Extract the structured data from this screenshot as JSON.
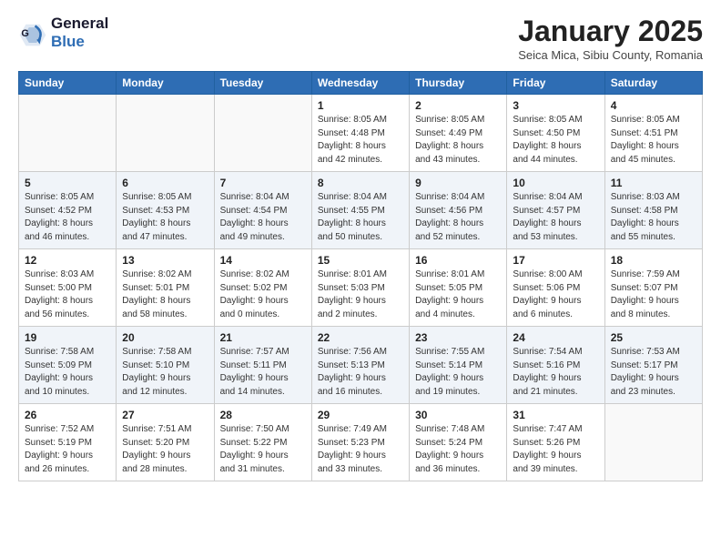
{
  "header": {
    "logo_line1": "General",
    "logo_line2": "Blue",
    "month_title": "January 2025",
    "subtitle": "Seica Mica, Sibiu County, Romania"
  },
  "weekdays": [
    "Sunday",
    "Monday",
    "Tuesday",
    "Wednesday",
    "Thursday",
    "Friday",
    "Saturday"
  ],
  "weeks": [
    [
      {
        "day": "",
        "sunrise": "",
        "sunset": "",
        "daylight": ""
      },
      {
        "day": "",
        "sunrise": "",
        "sunset": "",
        "daylight": ""
      },
      {
        "day": "",
        "sunrise": "",
        "sunset": "",
        "daylight": ""
      },
      {
        "day": "1",
        "sunrise": "Sunrise: 8:05 AM",
        "sunset": "Sunset: 4:48 PM",
        "daylight": "Daylight: 8 hours and 42 minutes."
      },
      {
        "day": "2",
        "sunrise": "Sunrise: 8:05 AM",
        "sunset": "Sunset: 4:49 PM",
        "daylight": "Daylight: 8 hours and 43 minutes."
      },
      {
        "day": "3",
        "sunrise": "Sunrise: 8:05 AM",
        "sunset": "Sunset: 4:50 PM",
        "daylight": "Daylight: 8 hours and 44 minutes."
      },
      {
        "day": "4",
        "sunrise": "Sunrise: 8:05 AM",
        "sunset": "Sunset: 4:51 PM",
        "daylight": "Daylight: 8 hours and 45 minutes."
      }
    ],
    [
      {
        "day": "5",
        "sunrise": "Sunrise: 8:05 AM",
        "sunset": "Sunset: 4:52 PM",
        "daylight": "Daylight: 8 hours and 46 minutes."
      },
      {
        "day": "6",
        "sunrise": "Sunrise: 8:05 AM",
        "sunset": "Sunset: 4:53 PM",
        "daylight": "Daylight: 8 hours and 47 minutes."
      },
      {
        "day": "7",
        "sunrise": "Sunrise: 8:04 AM",
        "sunset": "Sunset: 4:54 PM",
        "daylight": "Daylight: 8 hours and 49 minutes."
      },
      {
        "day": "8",
        "sunrise": "Sunrise: 8:04 AM",
        "sunset": "Sunset: 4:55 PM",
        "daylight": "Daylight: 8 hours and 50 minutes."
      },
      {
        "day": "9",
        "sunrise": "Sunrise: 8:04 AM",
        "sunset": "Sunset: 4:56 PM",
        "daylight": "Daylight: 8 hours and 52 minutes."
      },
      {
        "day": "10",
        "sunrise": "Sunrise: 8:04 AM",
        "sunset": "Sunset: 4:57 PM",
        "daylight": "Daylight: 8 hours and 53 minutes."
      },
      {
        "day": "11",
        "sunrise": "Sunrise: 8:03 AM",
        "sunset": "Sunset: 4:58 PM",
        "daylight": "Daylight: 8 hours and 55 minutes."
      }
    ],
    [
      {
        "day": "12",
        "sunrise": "Sunrise: 8:03 AM",
        "sunset": "Sunset: 5:00 PM",
        "daylight": "Daylight: 8 hours and 56 minutes."
      },
      {
        "day": "13",
        "sunrise": "Sunrise: 8:02 AM",
        "sunset": "Sunset: 5:01 PM",
        "daylight": "Daylight: 8 hours and 58 minutes."
      },
      {
        "day": "14",
        "sunrise": "Sunrise: 8:02 AM",
        "sunset": "Sunset: 5:02 PM",
        "daylight": "Daylight: 9 hours and 0 minutes."
      },
      {
        "day": "15",
        "sunrise": "Sunrise: 8:01 AM",
        "sunset": "Sunset: 5:03 PM",
        "daylight": "Daylight: 9 hours and 2 minutes."
      },
      {
        "day": "16",
        "sunrise": "Sunrise: 8:01 AM",
        "sunset": "Sunset: 5:05 PM",
        "daylight": "Daylight: 9 hours and 4 minutes."
      },
      {
        "day": "17",
        "sunrise": "Sunrise: 8:00 AM",
        "sunset": "Sunset: 5:06 PM",
        "daylight": "Daylight: 9 hours and 6 minutes."
      },
      {
        "day": "18",
        "sunrise": "Sunrise: 7:59 AM",
        "sunset": "Sunset: 5:07 PM",
        "daylight": "Daylight: 9 hours and 8 minutes."
      }
    ],
    [
      {
        "day": "19",
        "sunrise": "Sunrise: 7:58 AM",
        "sunset": "Sunset: 5:09 PM",
        "daylight": "Daylight: 9 hours and 10 minutes."
      },
      {
        "day": "20",
        "sunrise": "Sunrise: 7:58 AM",
        "sunset": "Sunset: 5:10 PM",
        "daylight": "Daylight: 9 hours and 12 minutes."
      },
      {
        "day": "21",
        "sunrise": "Sunrise: 7:57 AM",
        "sunset": "Sunset: 5:11 PM",
        "daylight": "Daylight: 9 hours and 14 minutes."
      },
      {
        "day": "22",
        "sunrise": "Sunrise: 7:56 AM",
        "sunset": "Sunset: 5:13 PM",
        "daylight": "Daylight: 9 hours and 16 minutes."
      },
      {
        "day": "23",
        "sunrise": "Sunrise: 7:55 AM",
        "sunset": "Sunset: 5:14 PM",
        "daylight": "Daylight: 9 hours and 19 minutes."
      },
      {
        "day": "24",
        "sunrise": "Sunrise: 7:54 AM",
        "sunset": "Sunset: 5:16 PM",
        "daylight": "Daylight: 9 hours and 21 minutes."
      },
      {
        "day": "25",
        "sunrise": "Sunrise: 7:53 AM",
        "sunset": "Sunset: 5:17 PM",
        "daylight": "Daylight: 9 hours and 23 minutes."
      }
    ],
    [
      {
        "day": "26",
        "sunrise": "Sunrise: 7:52 AM",
        "sunset": "Sunset: 5:19 PM",
        "daylight": "Daylight: 9 hours and 26 minutes."
      },
      {
        "day": "27",
        "sunrise": "Sunrise: 7:51 AM",
        "sunset": "Sunset: 5:20 PM",
        "daylight": "Daylight: 9 hours and 28 minutes."
      },
      {
        "day": "28",
        "sunrise": "Sunrise: 7:50 AM",
        "sunset": "Sunset: 5:22 PM",
        "daylight": "Daylight: 9 hours and 31 minutes."
      },
      {
        "day": "29",
        "sunrise": "Sunrise: 7:49 AM",
        "sunset": "Sunset: 5:23 PM",
        "daylight": "Daylight: 9 hours and 33 minutes."
      },
      {
        "day": "30",
        "sunrise": "Sunrise: 7:48 AM",
        "sunset": "Sunset: 5:24 PM",
        "daylight": "Daylight: 9 hours and 36 minutes."
      },
      {
        "day": "31",
        "sunrise": "Sunrise: 7:47 AM",
        "sunset": "Sunset: 5:26 PM",
        "daylight": "Daylight: 9 hours and 39 minutes."
      },
      {
        "day": "",
        "sunrise": "",
        "sunset": "",
        "daylight": ""
      }
    ]
  ]
}
